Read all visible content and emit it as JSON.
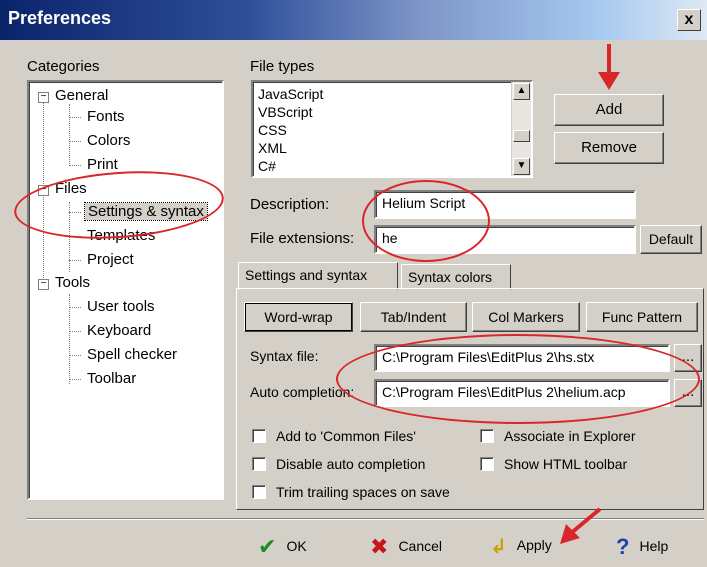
{
  "window": {
    "title": "Preferences",
    "close": "x"
  },
  "categories": {
    "label": "Categories",
    "tree": {
      "general": "General",
      "fonts": "Fonts",
      "colors": "Colors",
      "print": "Print",
      "files": "Files",
      "settings_syntax": "Settings & syntax",
      "templates": "Templates",
      "project": "Project",
      "tools": "Tools",
      "user_tools": "User tools",
      "keyboard": "Keyboard",
      "spell_checker": "Spell checker",
      "toolbar": "Toolbar",
      "expander_minus": "−"
    }
  },
  "file_types": {
    "label": "File types",
    "items": [
      "JavaScript",
      "VBScript",
      "CSS",
      "XML",
      "C#"
    ],
    "add": "Add",
    "remove": "Remove"
  },
  "description": {
    "label": "Description:",
    "value": "Helium Script"
  },
  "extensions": {
    "label": "File extensions:",
    "value": "he",
    "default_button": "Default"
  },
  "tabs": [
    "Settings and syntax",
    "Syntax colors"
  ],
  "sub_buttons": [
    "Word-wrap",
    "Tab/Indent",
    "Col Markers",
    "Func Pattern"
  ],
  "syntax_file": {
    "label": "Syntax file:",
    "value": "C:\\Program Files\\EditPlus 2\\hs.stx",
    "browse": "..."
  },
  "auto_completion": {
    "label": "Auto completion:",
    "value": "C:\\Program Files\\EditPlus 2\\helium.acp",
    "browse": "..."
  },
  "checkboxes": {
    "add_common": "Add to 'Common Files'",
    "associate": "Associate in Explorer",
    "disable_auto": "Disable auto completion",
    "show_html": "Show HTML toolbar",
    "trim_trailing": "Trim trailing spaces on save"
  },
  "actions": {
    "ok": "OK",
    "cancel": "Cancel",
    "apply": "Apply",
    "help": "Help"
  },
  "icons": {
    "ok": "check-icon",
    "cancel": "x-icon",
    "apply": "apply-arrow-icon",
    "help": "question-icon"
  },
  "colors": {
    "annotation": "#d9262a",
    "title_bar": "#0a246a"
  }
}
